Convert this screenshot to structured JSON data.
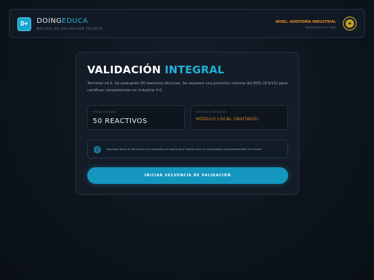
{
  "header": {
    "logo_text": "D+",
    "brand_primary": "DOING",
    "brand_accent": "EDUCA",
    "subtitle": "NÚCLEO DE VALIDACIÓN TÉCNICA",
    "level_label": "NIVEL: AUDITORÍA INDUSTRIAL",
    "protocol_label": "PROTOCOLO V.4.0 · 2024",
    "badge_icon": "medal-icon"
  },
  "card": {
    "title_primary": "VALIDACIÓN",
    "title_accent": "INTEGRAL",
    "description": "Terminal v4.0. Se evaluarán 50 reactivos técnicos. Se requiere una precisión mínima del 80% (8.0/10) para certificar competencias en Industria 4.0.",
    "stats": [
      {
        "label": "ITEMS TOTALES",
        "value": "50 REACTIVOS"
      },
      {
        "label": "ESTADO GUARDADO",
        "value": "MÓDULO LOCAL (INVITADO)"
      }
    ],
    "info_icon": "globe-icon",
    "info_text": "Operando fuera de red central. Los resultados se mostrarán al finalizar pero no se guardarán permanentemente en la nube.",
    "cta_label": "INICIAR SECUENCIA DE VALIDACIÓN"
  },
  "colors": {
    "accent": "#1fb3dd",
    "warning": "#e58a2a",
    "badge": "#d7b431",
    "background": "#0d141c"
  }
}
